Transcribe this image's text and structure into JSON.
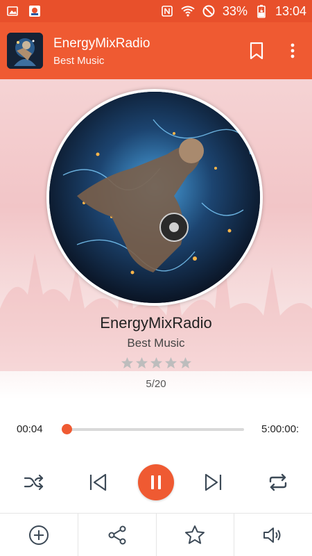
{
  "status_bar": {
    "battery": "33%",
    "time": "13:04",
    "icons": [
      "gallery-icon",
      "app-notification-icon",
      "nfc-icon",
      "wifi-icon",
      "no-entry-icon",
      "battery-charging-icon"
    ]
  },
  "app_bar": {
    "title": "EnergyMixRadio",
    "subtitle": "Best Music",
    "actions": [
      "bookmark-icon",
      "more-vert-icon"
    ]
  },
  "player": {
    "station_name": "EnergyMixRadio",
    "station_tagline": "Best Music",
    "rating_stars": 0,
    "rating_max": 5,
    "count_label": "5/20",
    "elapsed": "00:04",
    "total": "5:00:00:",
    "progress_fraction": 0.0
  },
  "controls": [
    "shuffle-icon",
    "skip-previous-icon",
    "pause-icon",
    "skip-next-icon",
    "repeat-icon"
  ],
  "bottom_bar": [
    "add-circle-icon",
    "share-icon",
    "star-outline-icon",
    "volume-icon"
  ],
  "colors": {
    "primary": "#ef5a32",
    "status_bar": "#e8502b",
    "star_inactive": "#bdbdbd"
  }
}
